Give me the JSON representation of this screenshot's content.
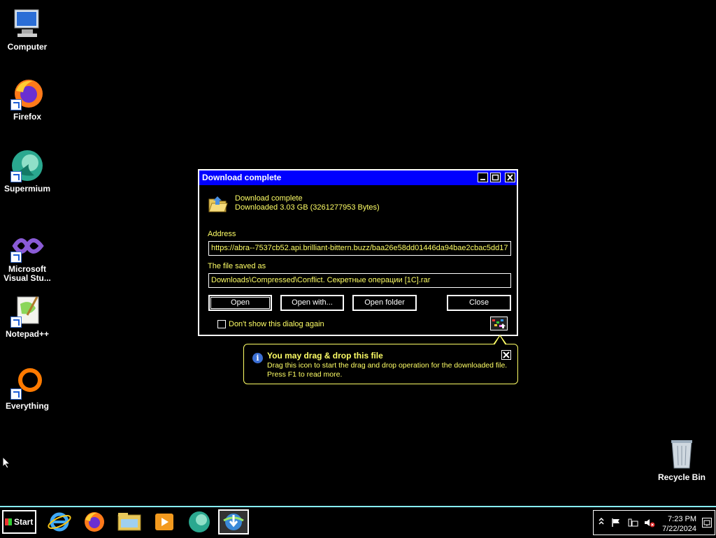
{
  "desktop": {
    "icons": [
      {
        "label": "Computer",
        "icon": "computer-icon"
      },
      {
        "label": "Firefox",
        "icon": "firefox-icon"
      },
      {
        "label": "Supermium",
        "icon": "supermium-icon"
      },
      {
        "label": "Microsoft Visual Stu...",
        "icon": "visual-studio-icon"
      },
      {
        "label": "Notepad++",
        "icon": "notepad-plus-plus-icon"
      },
      {
        "label": "Everything",
        "icon": "everything-icon"
      }
    ],
    "recycle_bin": "Recycle Bin"
  },
  "dialog": {
    "title": "Download complete",
    "status_title": "Download complete",
    "status_size": "Downloaded 3.03  GB (3261277953 Bytes)",
    "address_label": "Address",
    "address_value": "https://abra--7537cb52.api.brilliant-bittern.buzz/baa26e58dd01446da94bae2cbac5dd17",
    "saved_label": "The file saved as",
    "saved_value": "Downloads\\Compressed\\Conflict. Секретные операции [1C].rar",
    "buttons": {
      "open": "Open",
      "open_with": "Open with...",
      "open_folder": "Open folder",
      "close": "Close"
    },
    "dont_show": "Don't show this dialog again"
  },
  "balloon": {
    "title": "You may drag & drop this file",
    "line1": "Drag this icon to start the drag and drop operation for the downloaded file.",
    "line2": "Press F1 to read more."
  },
  "taskbar": {
    "start_label": "Start",
    "apps": [
      "internet-explorer-icon",
      "firefox-icon",
      "file-explorer-icon",
      "media-player-icon",
      "supermium-icon",
      "internet-download-manager-icon"
    ],
    "clock_time": "7:23 PM",
    "clock_date": "7/22/2024"
  },
  "colors": {
    "accent_text": "#ffff66",
    "titlebar": "#0000ff",
    "taskbar_border": "#88eeff"
  }
}
